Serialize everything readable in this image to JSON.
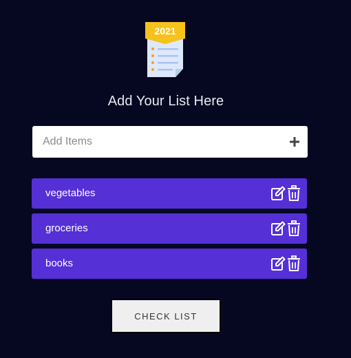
{
  "logo": {
    "year": "2021",
    "icon": "checklist-icon"
  },
  "heading": "Add Your List Here",
  "add_input": {
    "placeholder": "Add Items",
    "value": "",
    "icon": "plus-icon"
  },
  "items": [
    {
      "label": "vegetables"
    },
    {
      "label": "groceries"
    },
    {
      "label": "books"
    }
  ],
  "item_actions": {
    "edit_icon": "edit-icon",
    "delete_icon": "trash-icon"
  },
  "check_button": "CHECK LIST",
  "colors": {
    "background": "#060822",
    "item": "#5530d6",
    "logo_banner": "#f7c21b",
    "logo_paper": "#d9e8fb"
  }
}
